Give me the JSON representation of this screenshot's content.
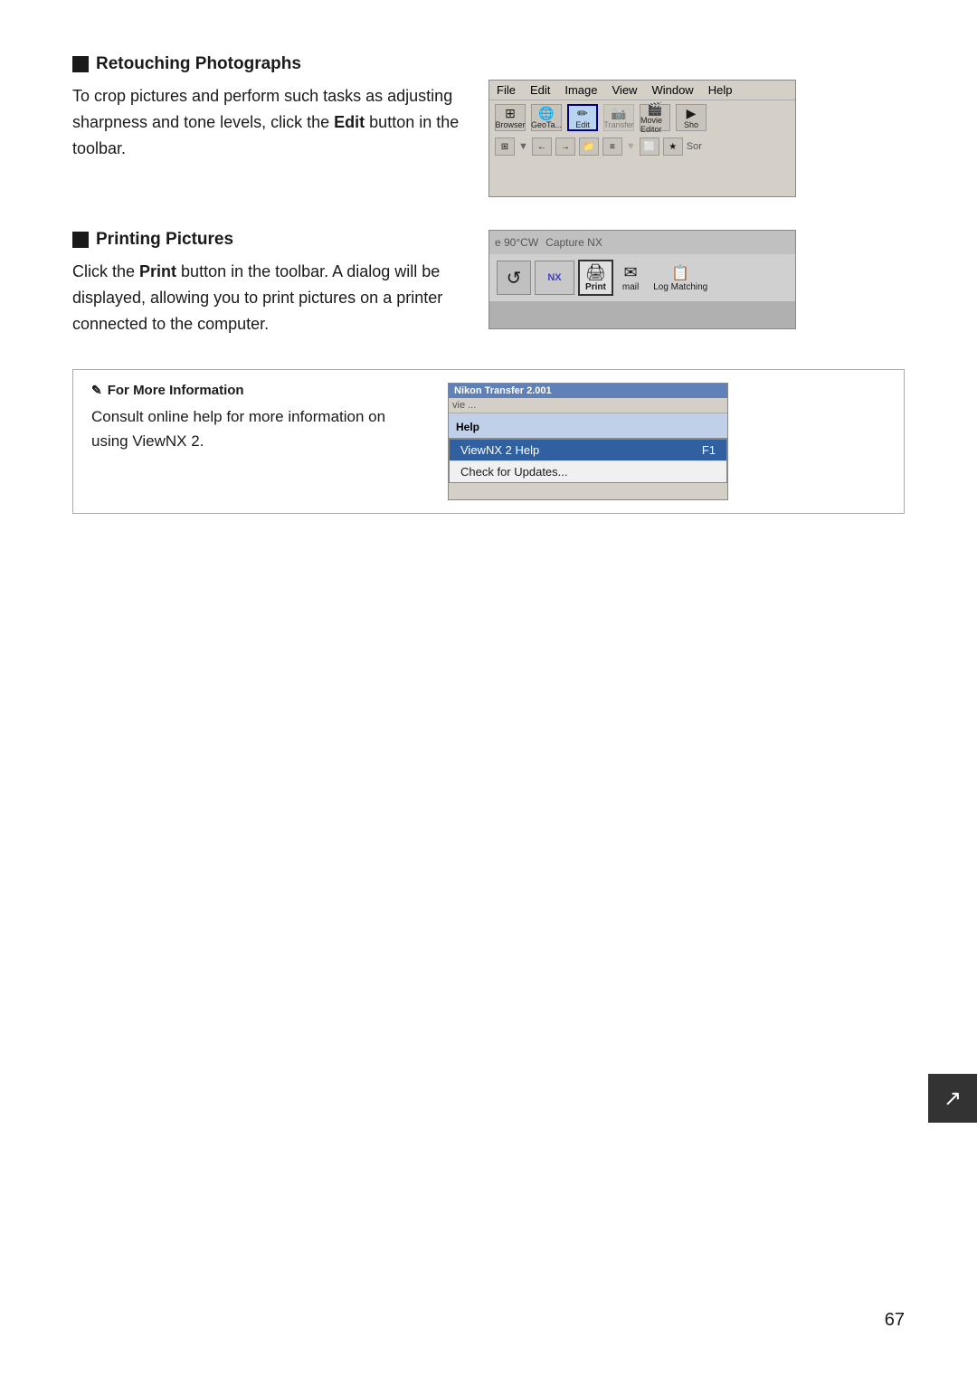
{
  "page": {
    "number": "67"
  },
  "retouching": {
    "heading": "Retouching Photographs",
    "body_1": "To crop pictures and perform such tasks as adjusting sharpness and tone levels, click the ",
    "bold_word": "Edit",
    "body_2": " button in the toolbar.",
    "screenshot_alt": "Retouching toolbar screenshot"
  },
  "printing": {
    "heading": "Printing Pictures",
    "body_1": "Click the ",
    "bold_word": "Print",
    "body_2": " button in the toolbar. A dialog will be displayed, allowing you to print pictures on a printer connected to the computer.",
    "screenshot_alt": "Printing toolbar screenshot"
  },
  "more_info": {
    "heading": "For More Information",
    "body": "Consult online help for more information on using ViewNX 2.",
    "screenshot_alt": "Help menu screenshot"
  },
  "toolbar1": {
    "menu_items": [
      "File",
      "Edit",
      "Image",
      "View",
      "Window",
      "Help"
    ],
    "buttons": [
      "Browser",
      "GeoTag",
      "Edit",
      "Transfer",
      "Movie Editor",
      "Sho"
    ],
    "edit_label": "Edit"
  },
  "toolbar2": {
    "rotate_label": "e 90°CW",
    "nx_label": "Capture NX",
    "print_label": "Print",
    "email_label": "mail",
    "log_label": "Log Matching"
  },
  "help_menu": {
    "titlebar": "Nikon Transfer 2.001",
    "menu_label": "Help",
    "item1_label": "ViewNX 2 Help",
    "item1_key": "F1",
    "item2_label": "Check for Updates..."
  },
  "bookmark": {
    "symbol": "↗"
  }
}
